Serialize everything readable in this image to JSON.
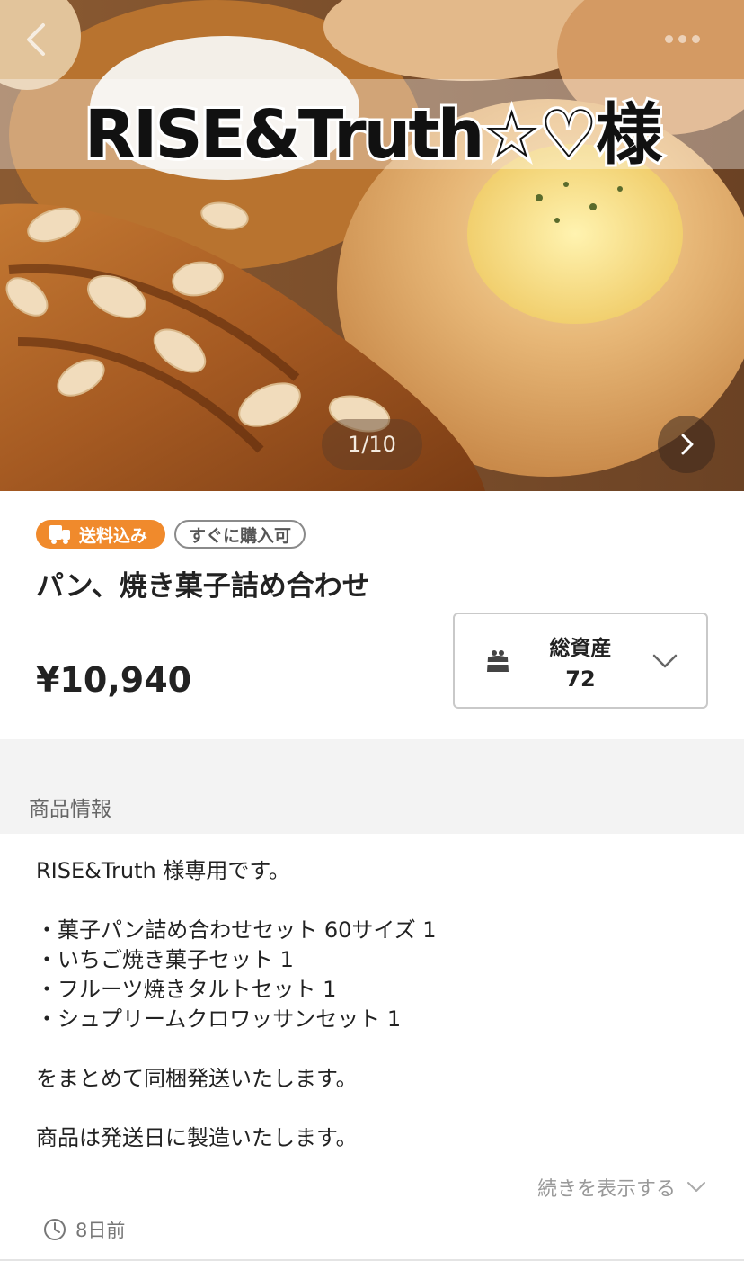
{
  "hero": {
    "title": "RISE&Truth☆♡様",
    "page_counter": "1/10"
  },
  "tags": {
    "shipping": "送料込み",
    "buy_now": "すぐに購入可"
  },
  "product": {
    "title": "パン、焼き菓子詰め合わせ",
    "price": "¥10,940"
  },
  "assets": {
    "label": "総資産",
    "value": "72"
  },
  "description": {
    "section_title": "商品情報",
    "lines": [
      "RISE&Truth 様専用です。",
      "",
      "・菓子パン詰め合わせセット 60サイズ 1",
      "・いちご焼き菓子セット 1",
      "・フルーツ焼きタルトセット 1",
      "・シュプリームクロワッサンセット 1",
      "",
      "をまとめて同梱発送いたします。",
      "",
      "商品は発送日に製造いたします。"
    ],
    "show_more": "続きを表示する"
  },
  "meta": {
    "posted": "8日前"
  },
  "colors": {
    "accent": "#f08a2c",
    "section_bg": "#f3f3f3"
  },
  "icons": [
    "back-arrow-icon",
    "more-dots-icon",
    "next-arrow-icon",
    "truck-icon",
    "wallet-icon",
    "chevron-down-icon",
    "clock-icon"
  ]
}
